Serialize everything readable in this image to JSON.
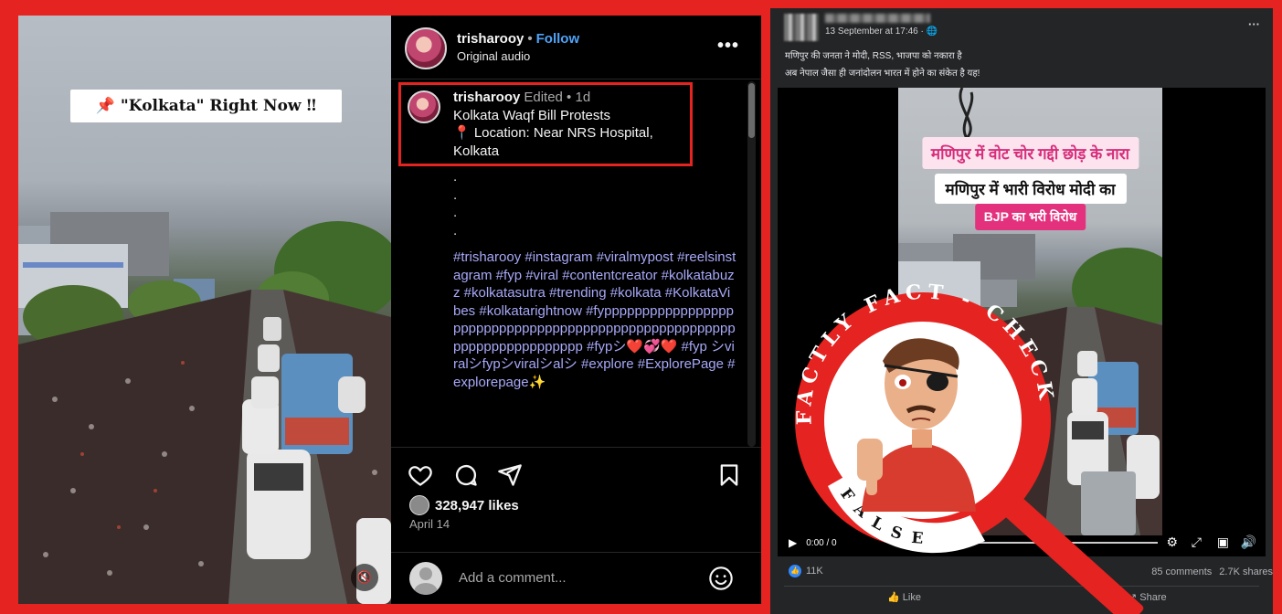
{
  "instagram": {
    "video_overlay": "📌 \"Kolkata\" Right Now ‼",
    "header": {
      "username": "trisharooy",
      "separator": "•",
      "follow": "Follow",
      "audio": "Original audio",
      "more": "•••"
    },
    "caption": {
      "username": "trisharooy",
      "meta": "Edited • 1d",
      "line1": "Kolkata Waqf Bill Protests",
      "line2": "📍 Location: Near NRS Hospital,",
      "line3": "Kolkata",
      "dots": [
        ".",
        ".",
        ".",
        "."
      ],
      "hashtags": "#trisharooy #instagram #viralmypost #reelsinstagram #fyp #viral #contentcreator #kolkatabuzz #kolkatasutra #trending #kolkata #KolkataVibes #kolkatarightnow #fyppppppppppppppppppppppppppppppppppppppppppppppppppppppppppppppppppppppp #fypシ❤️💞❤️ #fyp シviralシfypシviralシalシ #explore #ExplorePage #explorepage✨"
    },
    "likes": "328,947 likes",
    "date": "April 14",
    "comment_placeholder": "Add a comment...",
    "icons": [
      "heart-icon",
      "comment-icon",
      "share-icon",
      "bookmark-icon",
      "emoji-icon",
      "mute-icon"
    ]
  },
  "facebook": {
    "timestamp": "13 September at 17:46 · 🌐",
    "more": "···",
    "post_line1": "मणिपुर की जनता ने मोदी, RSS, भाजपा को नकारा है",
    "post_line2": "अब नेपाल जैसा ही जनांदोलन भारत में होने का संकेत है यह!",
    "video_banners": [
      "मणिपुर में वोट चोर गद्दी छोड़ के नारा",
      "मणिपुर में भारी विरोध मोदी का",
      "BJP का भरी विरोध"
    ],
    "video_time": "0:00 / 0",
    "reactions": "11K",
    "comments": "85 comments",
    "shares": "2.7K shares",
    "like_button": "Like",
    "share_button": "Share"
  },
  "stamp": {
    "ring_text": "FACTLY FACT - CHECK",
    "verdict": "FALSE",
    "color": "#e52320"
  }
}
